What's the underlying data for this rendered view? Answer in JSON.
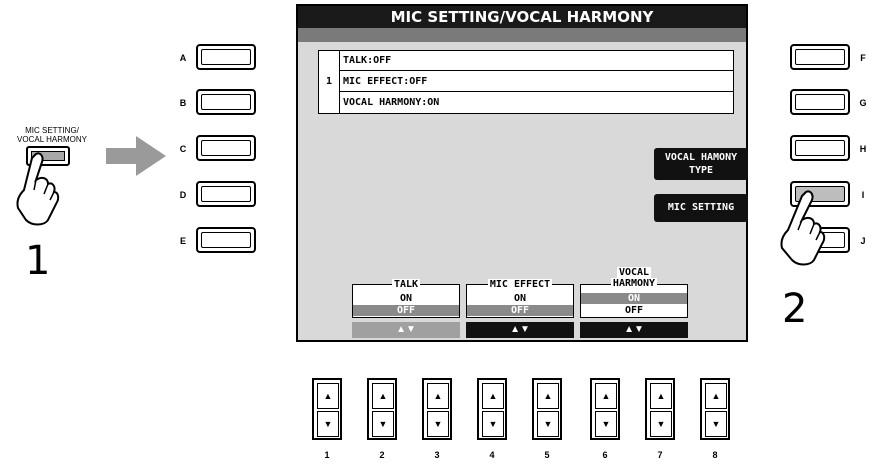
{
  "screen": {
    "title": "MIC SETTING/VOCAL HARMONY",
    "info": {
      "number": "1",
      "rows": [
        "TALK:OFF",
        "MIC EFFECT:OFF",
        "VOCAL HARMONY:ON"
      ]
    },
    "buttons": {
      "vocal_harmony_type": [
        "VOCAL HAMONY",
        "TYPE"
      ],
      "mic_setting": "MIC SETTING"
    },
    "params": [
      {
        "title": "TALK",
        "on": "ON",
        "off": "OFF",
        "selected": "off"
      },
      {
        "title": "MIC EFFECT",
        "on": "ON",
        "off": "OFF",
        "selected": "off"
      },
      {
        "title_lines": [
          "VOCAL",
          "HARMONY"
        ],
        "on": "ON",
        "off": "OFF",
        "selected": "on"
      }
    ],
    "arrows": "▲▼"
  },
  "panel": {
    "left_labels": [
      "A",
      "B",
      "C",
      "D",
      "E"
    ],
    "right_labels": [
      "F",
      "G",
      "H",
      "I",
      "J"
    ],
    "bottom_numbers": [
      "1",
      "2",
      "3",
      "4",
      "5",
      "6",
      "7",
      "8"
    ],
    "mic_button_label": [
      "MIC SETTING/",
      "VOCAL HARMONY"
    ],
    "step1": "1",
    "step2": "2"
  },
  "colors": {
    "screen_bg": "#d9d9d9",
    "title_bg": "#1a1a1a",
    "arrow_grey": "#999999"
  }
}
